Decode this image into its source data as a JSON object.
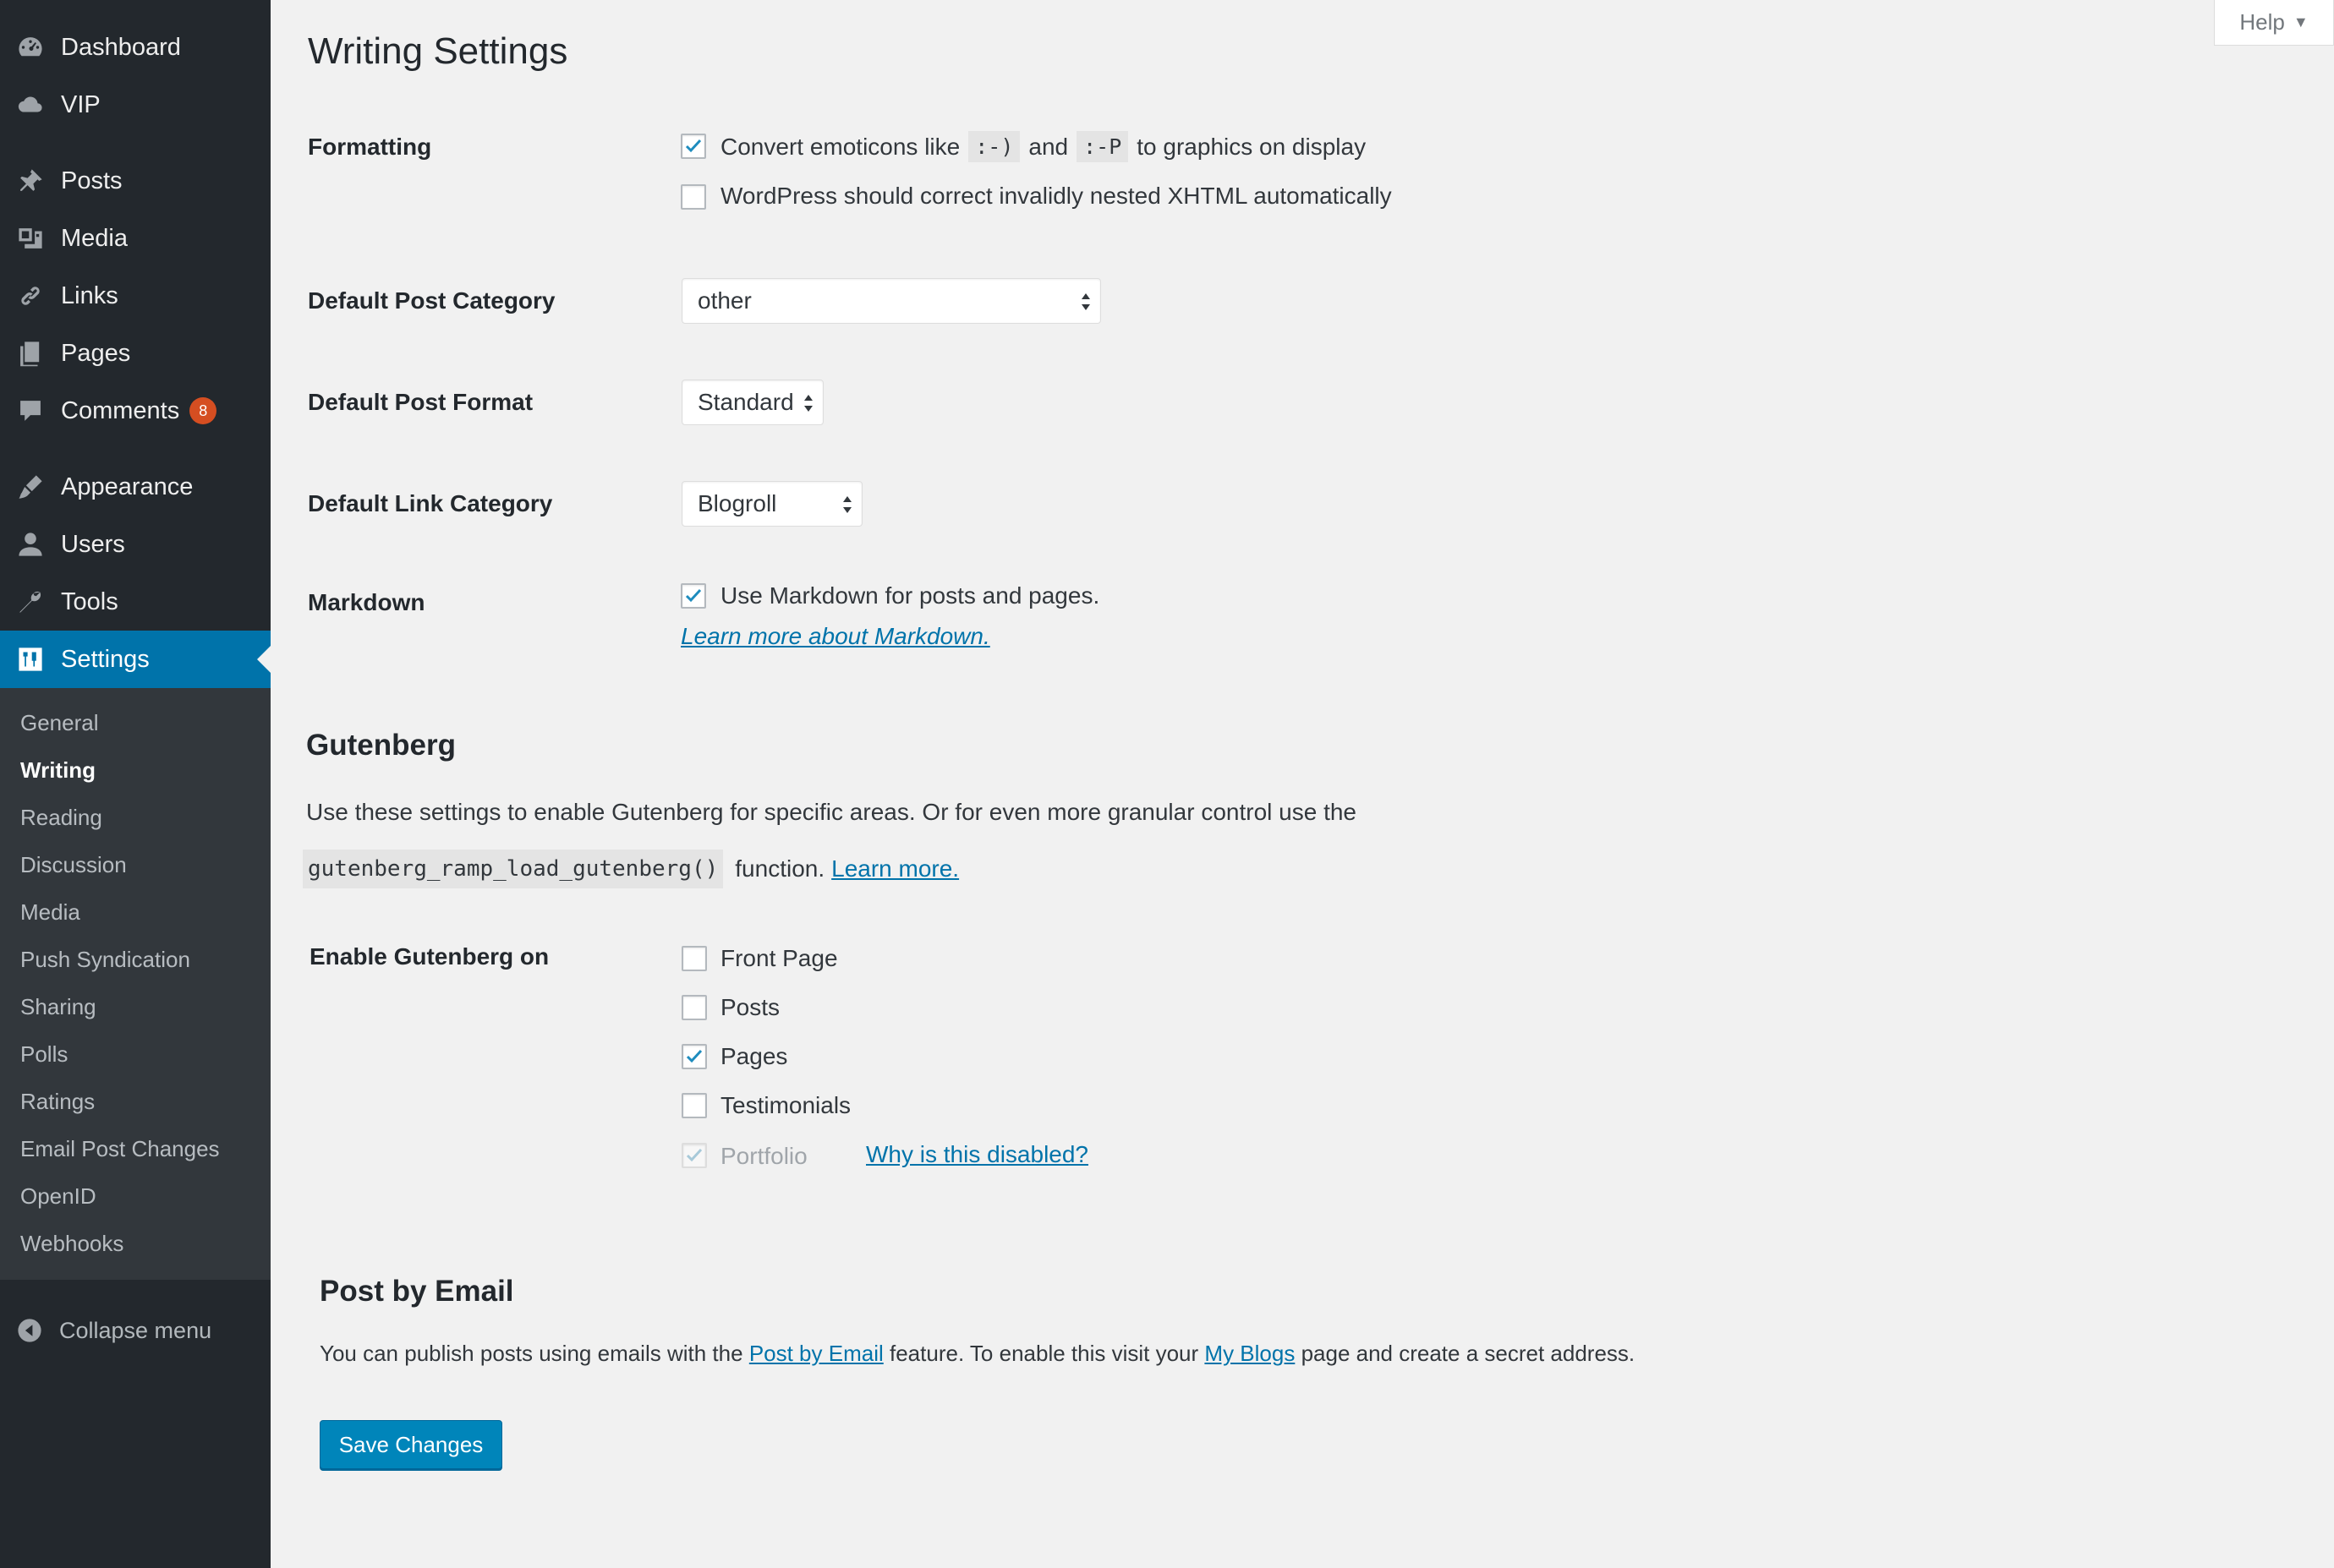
{
  "sidebar": {
    "items": [
      {
        "label": "Dashboard",
        "icon": "dashboard-icon"
      },
      {
        "label": "VIP",
        "icon": "cloud-icon"
      },
      {
        "label": "Posts",
        "icon": "pin-icon"
      },
      {
        "label": "Media",
        "icon": "media-icon"
      },
      {
        "label": "Links",
        "icon": "link-icon"
      },
      {
        "label": "Pages",
        "icon": "pages-icon"
      },
      {
        "label": "Comments",
        "icon": "comment-icon",
        "badge": "8"
      },
      {
        "label": "Appearance",
        "icon": "brush-icon"
      },
      {
        "label": "Users",
        "icon": "user-icon"
      },
      {
        "label": "Tools",
        "icon": "wrench-icon"
      },
      {
        "label": "Settings",
        "icon": "settings-icon"
      }
    ],
    "submenu": [
      "General",
      "Writing",
      "Reading",
      "Discussion",
      "Media",
      "Push Syndication",
      "Sharing",
      "Polls",
      "Ratings",
      "Email Post Changes",
      "OpenID",
      "Webhooks"
    ],
    "active_submenu": "Writing",
    "collapse_label": "Collapse menu"
  },
  "help": {
    "label": "Help"
  },
  "page": {
    "title": "Writing Settings"
  },
  "formatting": {
    "label": "Formatting",
    "emoticons": {
      "before": "Convert emoticons like",
      "code1": ":-)",
      "and": "and",
      "code2": ":-P",
      "after": "to graphics on display",
      "checked": true
    },
    "xhtml": {
      "label": "WordPress should correct invalidly nested XHTML automatically",
      "checked": false
    }
  },
  "default_post_category": {
    "label": "Default Post Category",
    "value": "other"
  },
  "default_post_format": {
    "label": "Default Post Format",
    "value": "Standard"
  },
  "default_link_category": {
    "label": "Default Link Category",
    "value": "Blogroll"
  },
  "markdown": {
    "label": "Markdown",
    "checkbox_label": "Use Markdown for posts and pages.",
    "checked": true,
    "learn_more": "Learn more about Markdown."
  },
  "gutenberg": {
    "title": "Gutenberg",
    "description": "Use these settings to enable Gutenberg for specific areas. Or for even more granular control use the",
    "code": "gutenberg_ramp_load_gutenberg()",
    "function_text": "function.",
    "learn_more": "Learn more.",
    "enable_label": "Enable Gutenberg on",
    "options": [
      {
        "label": "Front Page",
        "checked": false,
        "disabled": false
      },
      {
        "label": "Posts",
        "checked": false,
        "disabled": false
      },
      {
        "label": "Pages",
        "checked": true,
        "disabled": false
      },
      {
        "label": "Testimonials",
        "checked": false,
        "disabled": false
      },
      {
        "label": "Portfolio",
        "checked": true,
        "disabled": true
      }
    ],
    "why_disabled": "Why is this disabled?"
  },
  "post_by_email": {
    "title": "Post by Email",
    "text1": "You can publish posts using emails with the",
    "link1": "Post by Email",
    "text2": "feature. To enable this visit your",
    "link2": "My Blogs",
    "text3": "page and create a secret address."
  },
  "save_button": {
    "label": "Save Changes"
  },
  "colors": {
    "accent": "#0073aa",
    "sidebar": "#23282d",
    "submenu": "#32373c",
    "background": "#f1f1f1",
    "badge": "#d54e21",
    "button": "#0085ba"
  }
}
